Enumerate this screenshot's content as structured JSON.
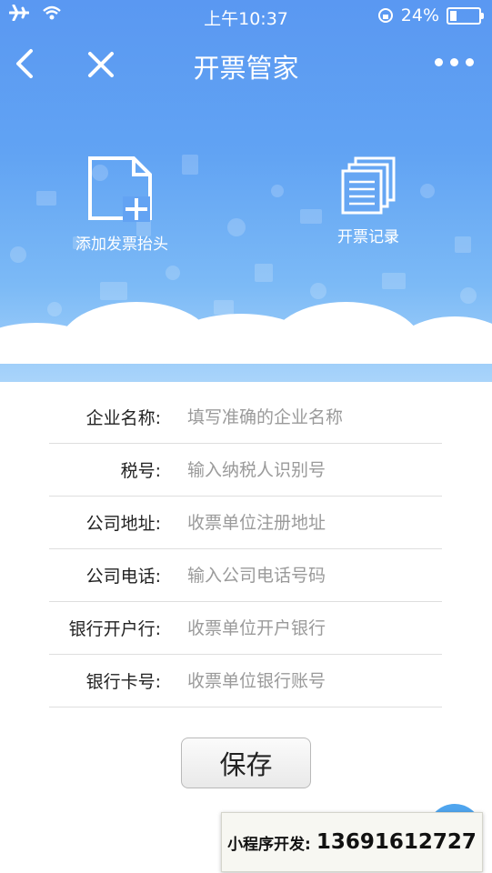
{
  "status": {
    "time": "上午10:37",
    "battery": "24%",
    "battery_level": 0.24
  },
  "nav": {
    "title": "开票管家"
  },
  "actions": {
    "add_header": "添加发票抬头",
    "records": "开票记录"
  },
  "form": {
    "fields": [
      {
        "label": "企业名称:",
        "placeholder": "填写准确的企业名称"
      },
      {
        "label": "税号:",
        "placeholder": "输入纳税人识别号"
      },
      {
        "label": "公司地址:",
        "placeholder": "收票单位注册地址"
      },
      {
        "label": "公司电话:",
        "placeholder": "输入公司电话号码"
      },
      {
        "label": "银行开户行:",
        "placeholder": "收票单位开户银行"
      },
      {
        "label": "银行卡号:",
        "placeholder": "收票单位银行账号"
      }
    ],
    "save_label": "保存"
  },
  "promo": {
    "label": "小程序开发:",
    "phone": "13691612727"
  },
  "colors": {
    "header_blue": "#5a98f2",
    "cloud": "#ffffff",
    "float_button": "#4fa5ee"
  }
}
